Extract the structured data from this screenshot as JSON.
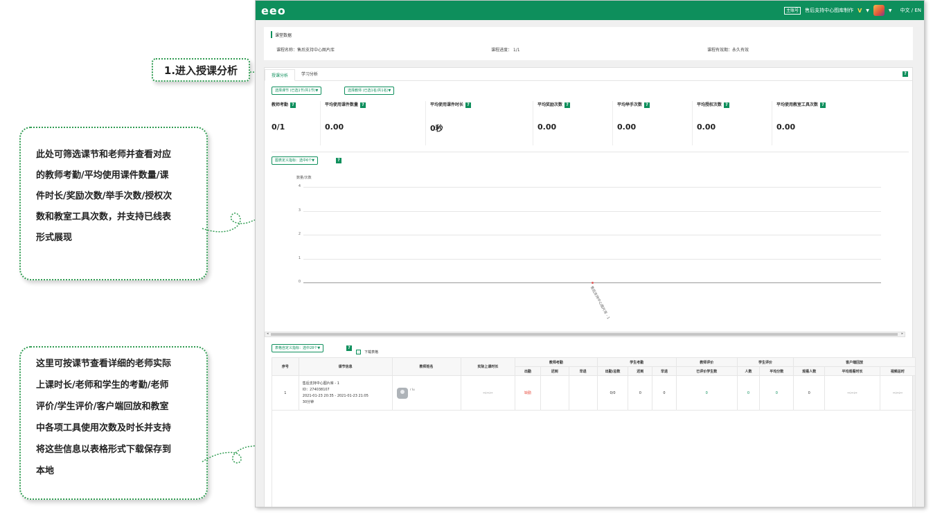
{
  "annotations": {
    "step_tag": "1.进入授课分析",
    "callout_top_lines": [
      "此处可筛选课节和老师并查看对应",
      "的教师考勤/平均使用课件数量/课",
      "件时长/奖励次数/举手次数/授权次",
      "数和教室工具次数，并支持已线表",
      "形式展现"
    ],
    "callout_bottom_lines": [
      "这里可按课节查看详细的老师实际",
      "上课时长/老师和学生的考勤/老师",
      "评价/学生评价/客户端回放和教室",
      "中各项工具使用次数及时长并支持",
      "将这些信息以表格形式下载保存到",
      "本地"
    ],
    "color_accent": "#2e9b50"
  },
  "topbar": {
    "logo": "eeo",
    "account_badge": "主账号",
    "org_name": "售后支持中心图库制作",
    "vip_mark": "V",
    "caret": "▼",
    "lang": "中文 / EN",
    "color": "#0e8f5c"
  },
  "info": {
    "section_title": "课堂数据",
    "course_name": "课程名称：售后支持中心图片库",
    "progress": "课程进度：  1/1",
    "validity": "课程有效期：永久有效"
  },
  "tabs": {
    "items": [
      "授课分析",
      "学习分析"
    ],
    "active": "授课分析",
    "help": "?"
  },
  "filters": {
    "lesson": "选择课节    (已选1节/共1节)▼",
    "teacher": "选择教师    (已选1名/共1名)▼"
  },
  "metrics": [
    {
      "label": "教师考勤",
      "value": "0/1"
    },
    {
      "label": "平均使用课件数量",
      "value": "0.00"
    },
    {
      "label": "平均使用课件时长",
      "value": "0秒"
    },
    {
      "label": "平均奖励次数",
      "value": "0.00"
    },
    {
      "label": "平均举手次数",
      "value": "0.00"
    },
    {
      "label": "平均授权次数",
      "value": "0.00"
    },
    {
      "label": "平均使用教室工具次数",
      "value": "0.00"
    }
  ],
  "chart_controls": {
    "custom_metric": "图表定义指标：选中6个▼"
  },
  "chart_data": {
    "type": "line",
    "ylabel": "数量/次数",
    "ylim": [
      0,
      4
    ],
    "yticks": [
      "0",
      "1",
      "2",
      "3",
      "4"
    ],
    "categories": [
      "售后支持中心图片库 - 1"
    ],
    "grid": true
  },
  "table_controls": {
    "custom_metric": "表格自定义指标：选中28个▼",
    "download": "下载表格"
  },
  "table": {
    "group_headers": {
      "index": "序号",
      "course_info": "课节信息",
      "teacher_name": "教师姓名",
      "actual_duration": "实际上课时长",
      "teacher_attendance": "教师考勤",
      "student_attendance": "学生考勤",
      "teacher_eval": "教师评价",
      "student_eval": "学生评价",
      "client_replay": "客户端回放"
    },
    "sub_headers": {
      "t_present": "出勤",
      "t_late": "迟到",
      "t_early": "早退",
      "s_present": "出勤/总数",
      "s_late": "迟到",
      "s_early": "早退",
      "evaluated_students": "已评价学生数",
      "eval_count": "人数",
      "avg_score": "平均分数",
      "viewers": "观看人数",
      "avg_watch": "平均观看时长",
      "video_total": "视频总时"
    },
    "row": {
      "index": "1",
      "course_title": "售后支持中心图片库 - 1",
      "course_id": "ID：274038107",
      "course_time": "2021-01-23 20:35 - 2021-01-23 21:05",
      "course_len": "30分钟",
      "teacher_name": "r lu",
      "actual_duration": "--:--:--",
      "t_present": "缺勤",
      "t_late": "",
      "t_early": "",
      "s_present": "0/0",
      "s_late": "0",
      "s_early": "0",
      "evaluated_students": "0",
      "eval_count": "0",
      "avg_score": "0",
      "viewers": "0",
      "avg_watch": "--:--:--",
      "video_total": "--:--:--"
    }
  }
}
